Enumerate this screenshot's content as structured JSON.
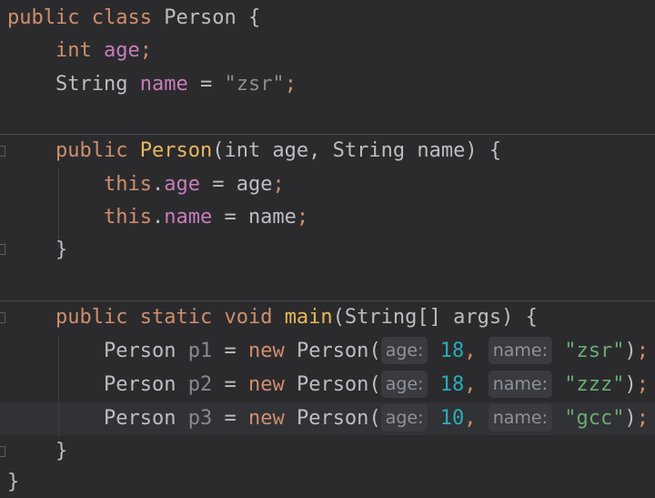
{
  "code": {
    "kw_public": "public",
    "kw_class": "class",
    "class_name": "Person",
    "open_brace": "{",
    "close_brace": "}",
    "kw_int": "int",
    "field_age": "age",
    "semicolon": ";",
    "type_string": "String",
    "field_name": "name",
    "equals": "=",
    "default_name_literal": "\"zsr\"",
    "constructor_name": "Person",
    "param_list": "(int age, String name) {",
    "kw_this": "this",
    "dot": ".",
    "param_age": "age",
    "param_name": "name",
    "kw_static": "static",
    "kw_void": "void",
    "method_main": "main",
    "main_params": "(String[] args) {",
    "kw_new": "new",
    "hint_age": "age:",
    "hint_name": "name:",
    "calls": [
      {
        "var": "p1",
        "age": "18",
        "name": "\"zsr\""
      },
      {
        "var": "p2",
        "age": "18",
        "name": "\"zzz\""
      },
      {
        "var": "p3",
        "age": "10",
        "name": "\"gcc\""
      }
    ]
  },
  "colors": {
    "background": "#2b2b2d",
    "keyword": "#cf8e6d",
    "declaration": "#e8b85a",
    "field": "#c77dbb",
    "string": "#6aab73",
    "number": "#2aacb8"
  }
}
